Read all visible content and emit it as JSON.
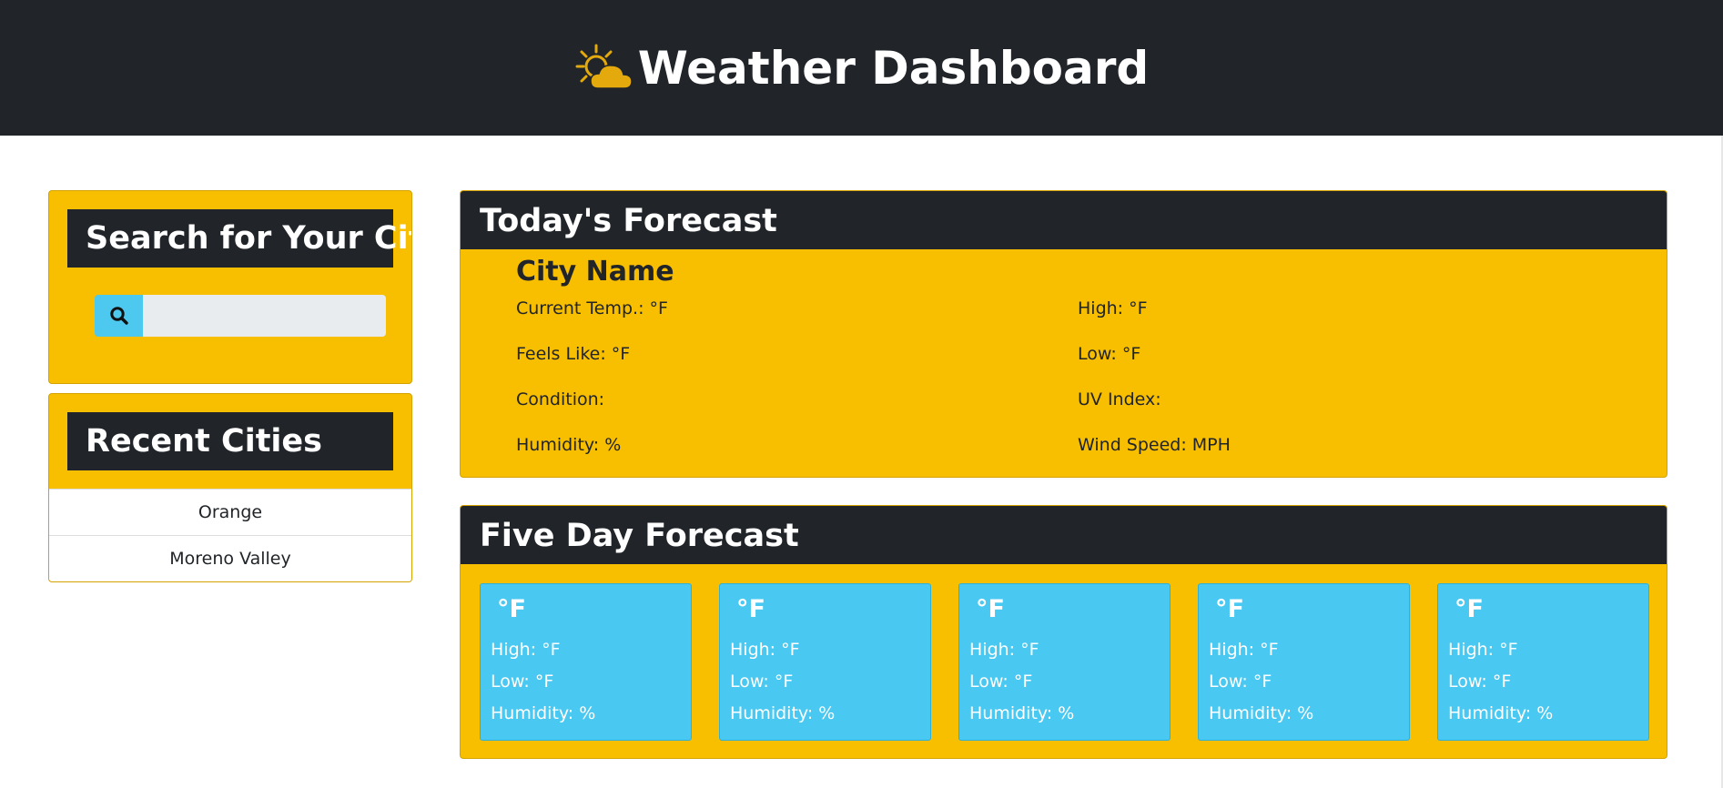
{
  "header": {
    "title": "Weather Dashboard",
    "icon": "sun-behind-cloud-icon",
    "background": "#212529",
    "accent": "#e4aa0d"
  },
  "search": {
    "heading": "Search for Your City",
    "input_value": "",
    "placeholder": "",
    "button_icon": "search-icon"
  },
  "recent": {
    "heading": "Recent Cities",
    "items": [
      "Orange",
      "Moreno Valley"
    ]
  },
  "today": {
    "heading": "Today's Forecast",
    "city": "City Name",
    "current_temp": "Current Temp.: °F",
    "feels_like": "Feels Like: °F",
    "condition": "Condition:",
    "humidity": "Humidity: %",
    "high": "High: °F",
    "low": "Low: °F",
    "uv_index": "UV Index:",
    "wind_speed": "Wind Speed: MPH"
  },
  "five_day": {
    "heading": "Five Day Forecast",
    "days": [
      {
        "temp": "°F",
        "high": "High: °F",
        "low": "Low: °F",
        "humidity": "Humidity: %"
      },
      {
        "temp": "°F",
        "high": "High: °F",
        "low": "Low: °F",
        "humidity": "Humidity: %"
      },
      {
        "temp": "°F",
        "high": "High: °F",
        "low": "Low: °F",
        "humidity": "Humidity: %"
      },
      {
        "temp": "°F",
        "high": "High: °F",
        "low": "Low: °F",
        "humidity": "Humidity: %"
      },
      {
        "temp": "°F",
        "high": "High: °F",
        "low": "Low: °F",
        "humidity": "Humidity: %"
      }
    ]
  },
  "colors": {
    "card_yellow": "#f8be00",
    "dark": "#212529",
    "day_card_blue": "#49c8f1",
    "search_button": "#4dc8ee",
    "input_gray": "#e9ecef"
  }
}
